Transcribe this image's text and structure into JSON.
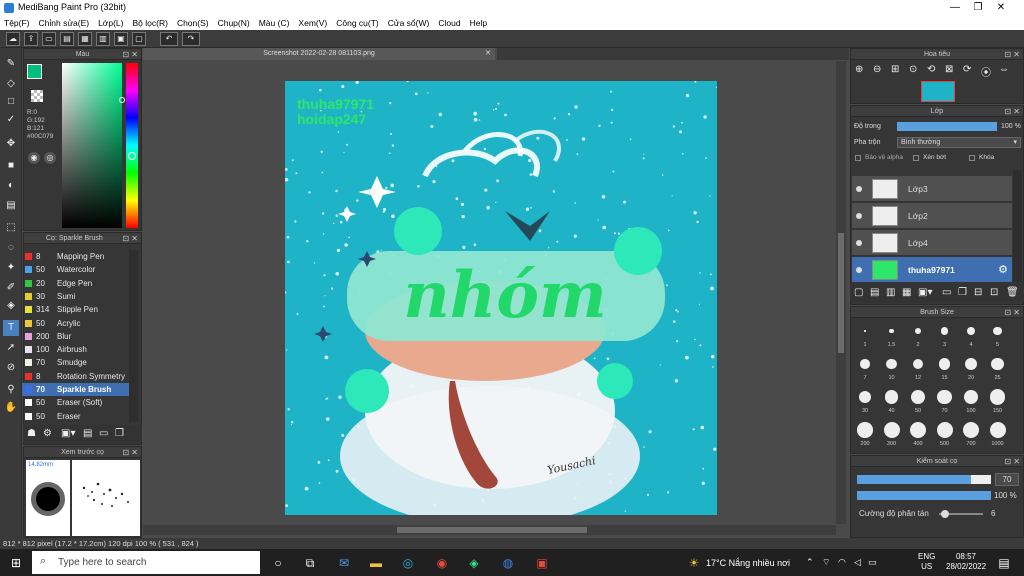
{
  "window": {
    "title": "MediBang Paint Pro (32bit)",
    "min": "—",
    "max": "❐",
    "close": "✕"
  },
  "menu": [
    "Tệp(F)",
    "Chỉnh sửa(E)",
    "Lớp(L)",
    "Bộ lọc(R)",
    "Chọn(S)",
    "Chụp(N)",
    "Màu (C)",
    "Xem(V)",
    "Công cụ(T)",
    "Cửa sổ(W)",
    "Cloud",
    "Help"
  ],
  "color_panel": {
    "title": "Màu",
    "r": "R:0",
    "g": "G:192",
    "b": "B:121",
    "hex": "#00C079"
  },
  "brush_panel": {
    "title": "Cọ: Sparkle Brush",
    "items": [
      {
        "size": "8",
        "name": "Mapping Pen",
        "color": "#e8312f"
      },
      {
        "size": "50",
        "name": "Watercolor",
        "color": "#4ea0e8"
      },
      {
        "size": "20",
        "name": "Edge Pen",
        "color": "#33c24a"
      },
      {
        "size": "30",
        "name": "Sumi",
        "color": "#e8c838"
      },
      {
        "size": "314",
        "name": "Stipple Pen",
        "color": "#e8e038"
      },
      {
        "size": "50",
        "name": "Acrylic",
        "color": "#e8c838"
      },
      {
        "size": "200",
        "name": "Blur",
        "color": "#e8a0e0"
      },
      {
        "size": "100",
        "name": "Airbrush",
        "color": "#e8e0f0"
      },
      {
        "size": "70",
        "name": "Smudge",
        "color": "#f0f0e0"
      },
      {
        "size": "8",
        "name": "Rotation Symmetry",
        "color": "#e8312f"
      },
      {
        "size": "70",
        "name": "Sparkle Brush",
        "color": "#3a6fe8"
      },
      {
        "size": "50",
        "name": "Eraser (Soft)",
        "color": "#ffffff"
      },
      {
        "size": "50",
        "name": "Eraser",
        "color": "#ffffff"
      }
    ]
  },
  "preview_panel": {
    "title": "Xem trước cọ",
    "size": "14.82mm"
  },
  "document": {
    "tab": "Screenshot 2022-02-28 081103.png",
    "watermark1": "thuha97971",
    "watermark2": "hoidap247",
    "art_text": "nhóm",
    "signature": "Yousachi"
  },
  "navigator": {
    "title": "Hoa tiêu"
  },
  "layers_panel": {
    "title": "Lớp",
    "opacity_label": "Độ trong",
    "opacity_value": "100 %",
    "blend_label": "Pha trộn",
    "blend_value": "Bình thường",
    "protect_alpha": "Bảo vệ alpha",
    "clip": "Xén bớt",
    "lock": "Khóa",
    "layers": [
      {
        "name": "Lớp3"
      },
      {
        "name": "Lớp2"
      },
      {
        "name": "Lớp4"
      },
      {
        "name": "thuha97971"
      }
    ]
  },
  "brush_size_panel": {
    "title": "Brush Size",
    "sizes": [
      "1",
      "1.5",
      "2",
      "3",
      "4",
      "5",
      "7",
      "10",
      "12",
      "15",
      "20",
      "25",
      "30",
      "40",
      "50",
      "70",
      "100",
      "150",
      "200",
      "300",
      "400",
      "500",
      "700",
      "1000"
    ]
  },
  "brush_control": {
    "title": "Kiểm soát cọ",
    "size_value": "70",
    "opacity_value": "100 %",
    "scatter_label": "Cường độ phân tán",
    "scatter_value": "6",
    "size_frac": 0.85,
    "opacity_frac": 1.0
  },
  "status": {
    "text": "812 * 812 pixel   (17.2 * 17.2cm)   120 dpi   100 %   ( 531 , 824 )"
  },
  "taskbar": {
    "search_placeholder": "Type here to search",
    "weather": "17°C  Nắng nhiều nơi",
    "lang1": "ENG",
    "lang2": "US",
    "time": "08:57",
    "date": "28/02/2022"
  }
}
